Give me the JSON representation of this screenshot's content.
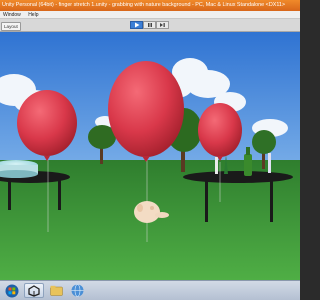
{
  "window": {
    "title": "Unity Personal (64bit) - finger stretch 1.unity - grabbing with nature background - PC, Mac & Linux Standalone <DX11>"
  },
  "menu": {
    "items": [
      "Window",
      "Help"
    ]
  },
  "toolbar": {
    "layers_label": "Layout",
    "play_buttons": [
      {
        "icon": "play-icon",
        "active": true
      },
      {
        "icon": "pause-icon",
        "active": false
      },
      {
        "icon": "step-icon",
        "active": false
      }
    ]
  },
  "scene": {
    "balloons": [
      {
        "name": "left",
        "color": "#e23d4c"
      },
      {
        "name": "center",
        "color": "#d93a4b"
      },
      {
        "name": "right",
        "color": "#e0404d"
      }
    ],
    "sky_color": "#3a7fd9",
    "grass_color": "#3f9a3c"
  },
  "taskbar": {
    "items": [
      {
        "icon": "start-orb-icon"
      },
      {
        "icon": "unity-icon",
        "active": true
      },
      {
        "icon": "folder-icon"
      },
      {
        "icon": "browser-icon"
      }
    ]
  }
}
